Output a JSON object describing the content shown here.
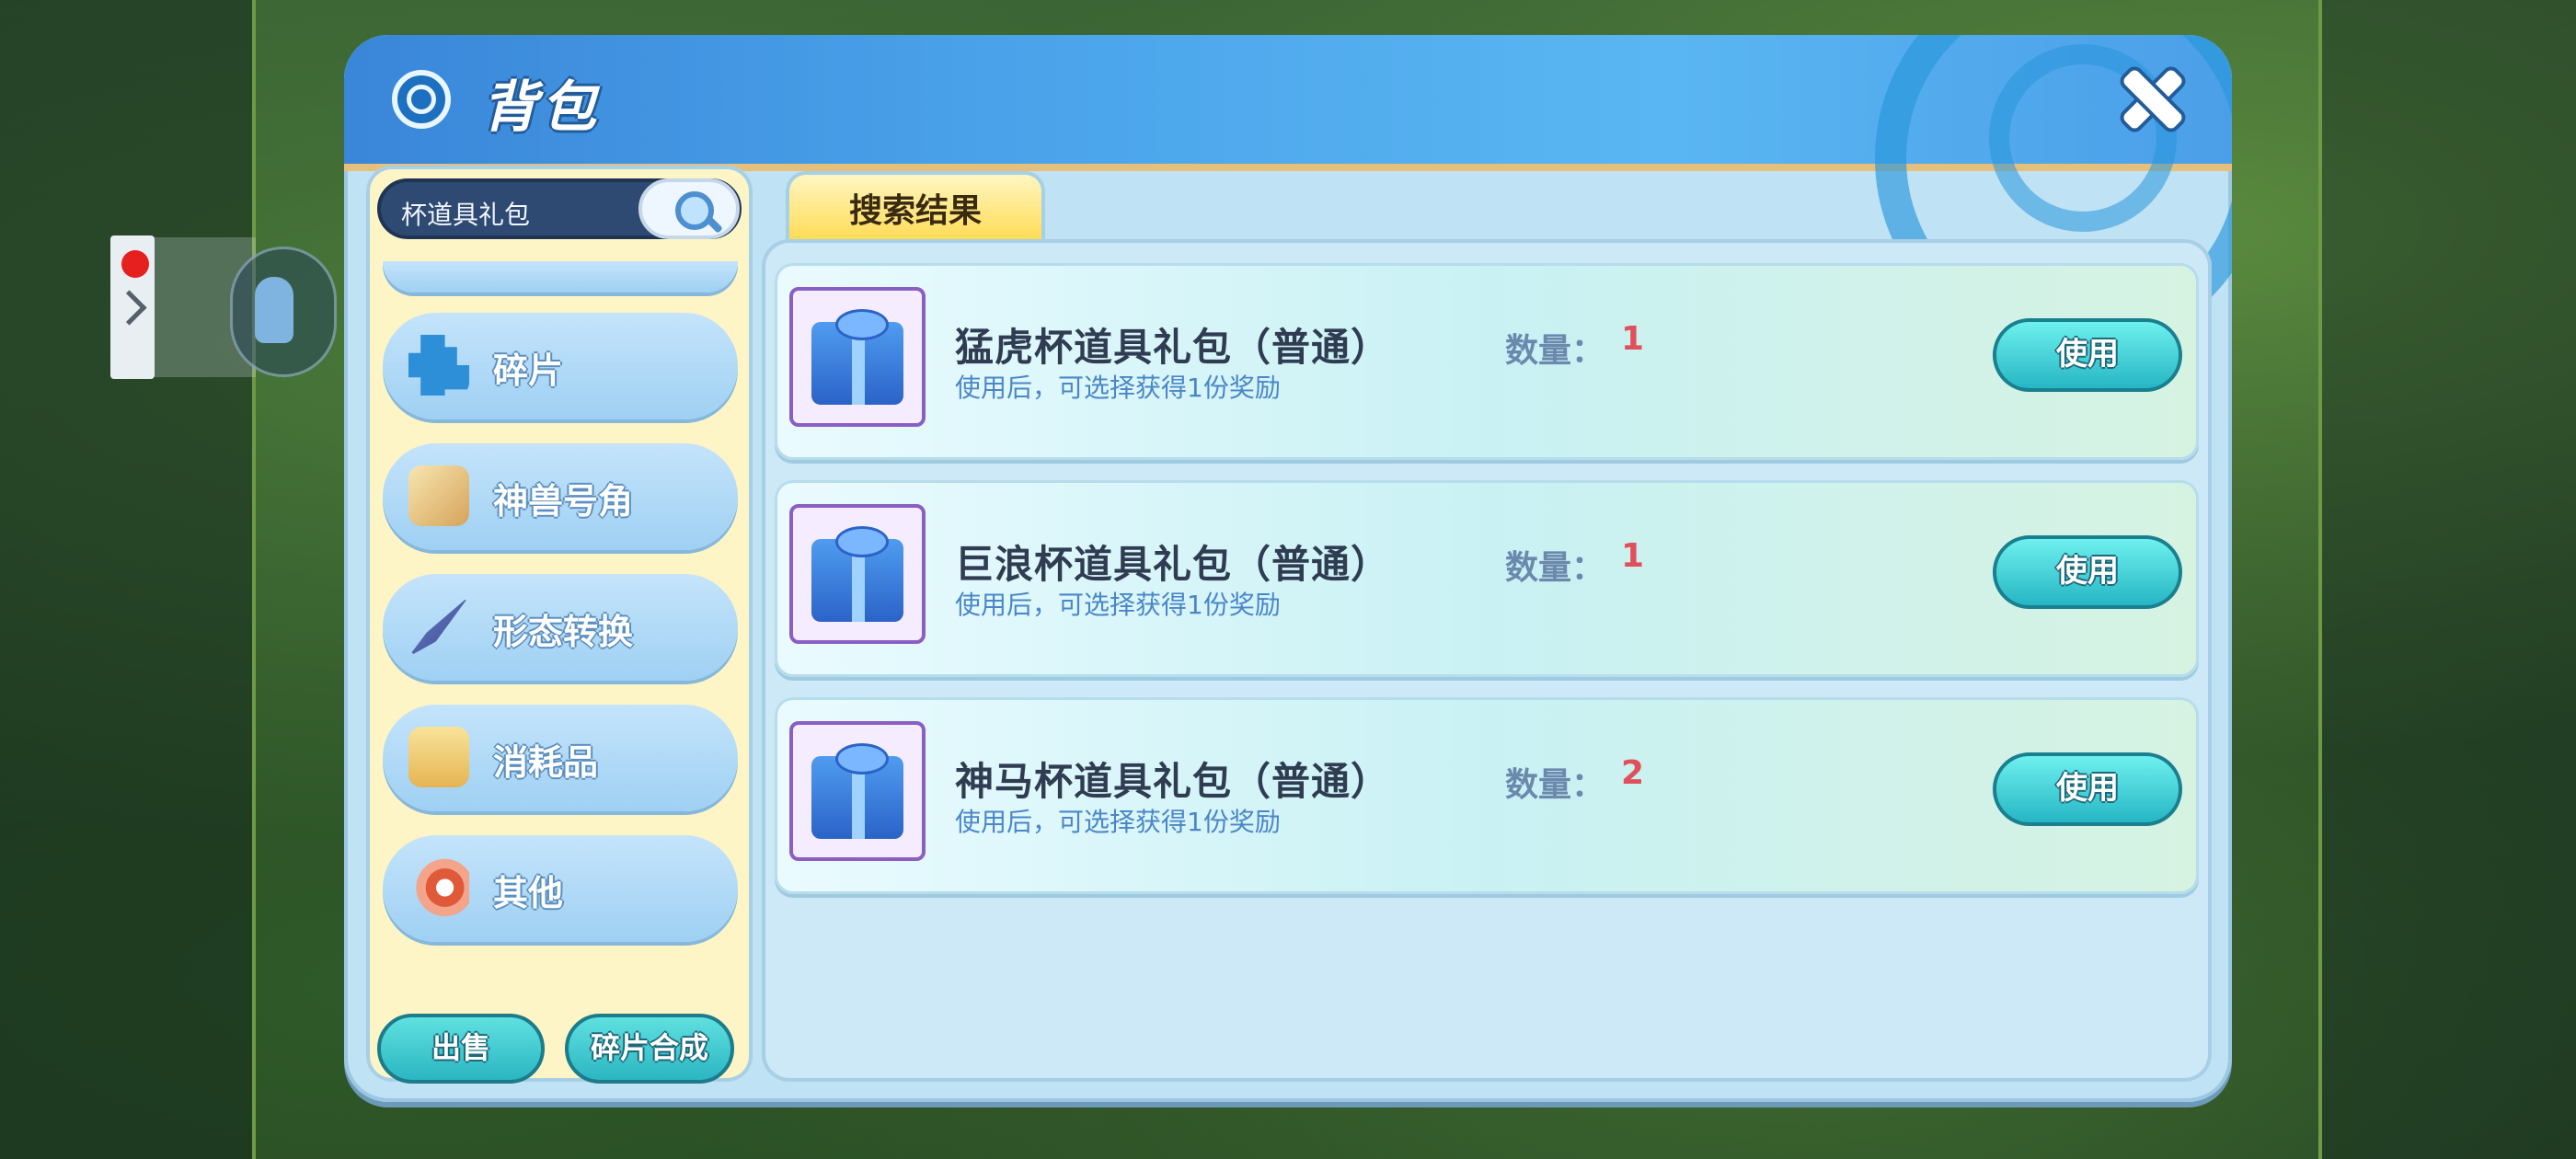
{
  "panel": {
    "title": "背包"
  },
  "search": {
    "value": "杯道具礼包"
  },
  "categories": [
    {
      "label": "碎片",
      "icon": "puzzle-icon"
    },
    {
      "label": "神兽号角",
      "icon": "horn-icon"
    },
    {
      "label": "形态转换",
      "icon": "shard-icon"
    },
    {
      "label": "消耗品",
      "icon": "box-icon"
    },
    {
      "label": "其他",
      "icon": "speaker-icon"
    }
  ],
  "bottom_buttons": {
    "sell": "出售",
    "synthesize": "碎片合成"
  },
  "tab": {
    "label": "搜索结果"
  },
  "items": [
    {
      "name": "猛虎杯道具礼包（普通）",
      "desc": "使用后，可选择获得1份奖励",
      "qty_label": "数量：",
      "qty": "1",
      "use": "使用"
    },
    {
      "name": "巨浪杯道具礼包（普通）",
      "desc": "使用后，可选择获得1份奖励",
      "qty_label": "数量：",
      "qty": "1",
      "use": "使用"
    },
    {
      "name": "神马杯道具礼包（普通）",
      "desc": "使用后，可选择获得1份奖励",
      "qty_label": "数量：",
      "qty": "2",
      "use": "使用"
    }
  ],
  "colors": {
    "accent": "#2bb6c2",
    "header": "#4aa3ea",
    "quantity": "#e0505a"
  }
}
